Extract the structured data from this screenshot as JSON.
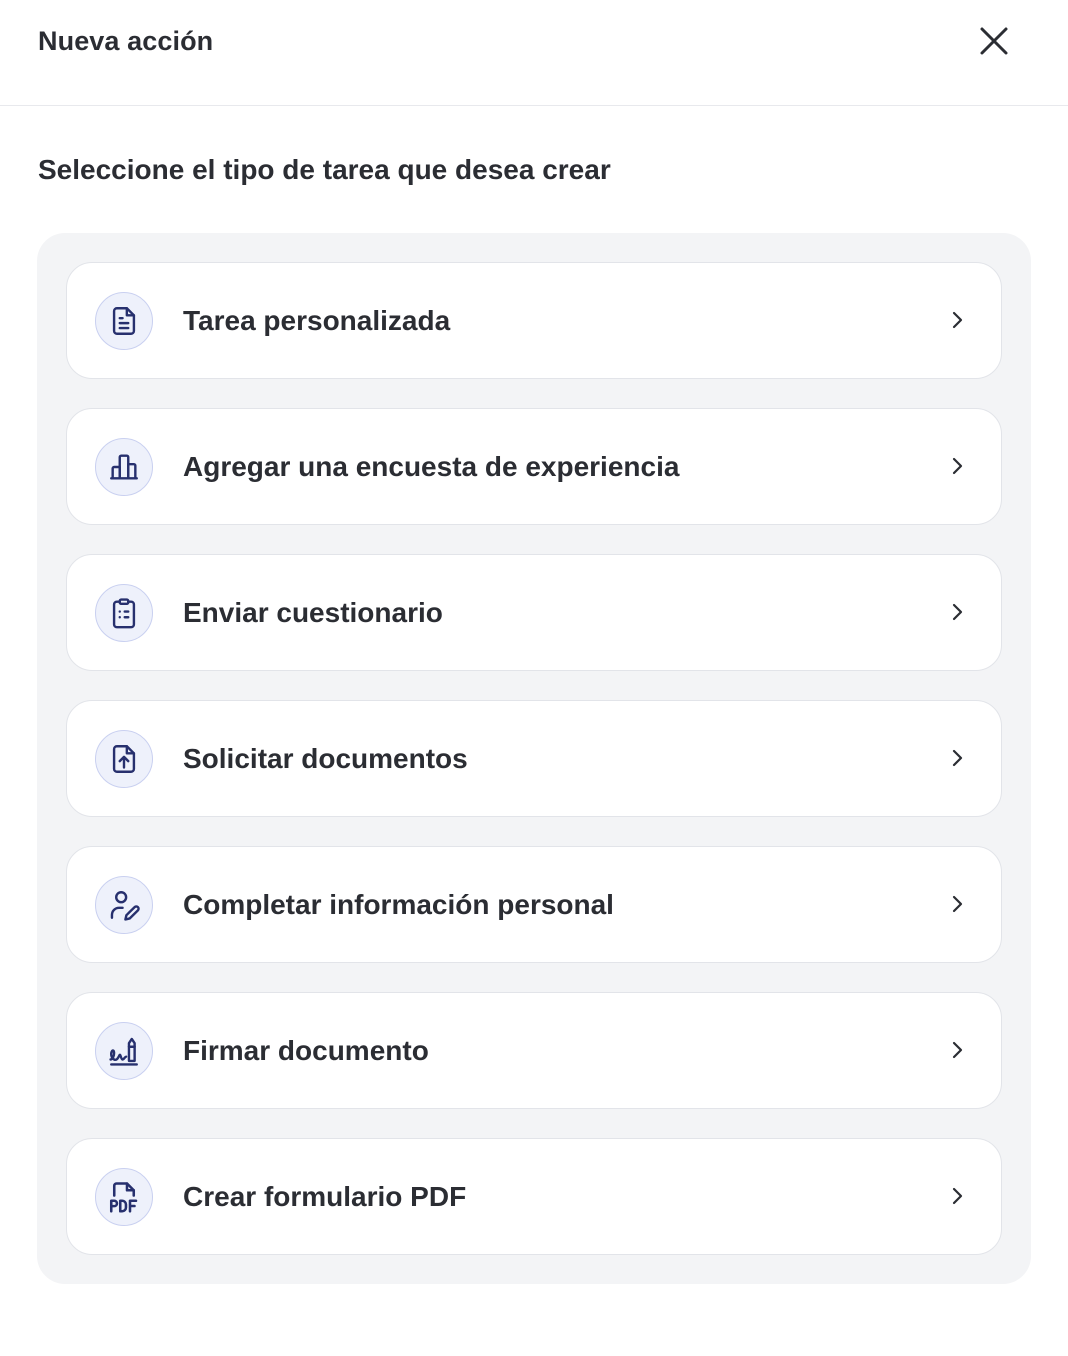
{
  "header": {
    "title": "Nueva acción",
    "close_icon": "close-icon"
  },
  "subtitle": "Seleccione el tipo de tarea que desea crear",
  "colors": {
    "icon_stroke": "#27306e",
    "icon_bg": "#eef1fb",
    "panel_bg": "#f3f4f6",
    "text": "#2b2d33"
  },
  "options": [
    {
      "label": "Tarea personalizada",
      "icon": "document-icon"
    },
    {
      "label": "Agregar una encuesta de experiencia",
      "icon": "bar-chart-icon"
    },
    {
      "label": "Enviar cuestionario",
      "icon": "clipboard-list-icon"
    },
    {
      "label": "Solicitar documentos",
      "icon": "file-upload-icon"
    },
    {
      "label": "Completar información personal",
      "icon": "user-edit-icon"
    },
    {
      "label": "Firmar documento",
      "icon": "signature-icon"
    },
    {
      "label": "Crear formulario PDF",
      "icon": "pdf-file-icon"
    }
  ]
}
